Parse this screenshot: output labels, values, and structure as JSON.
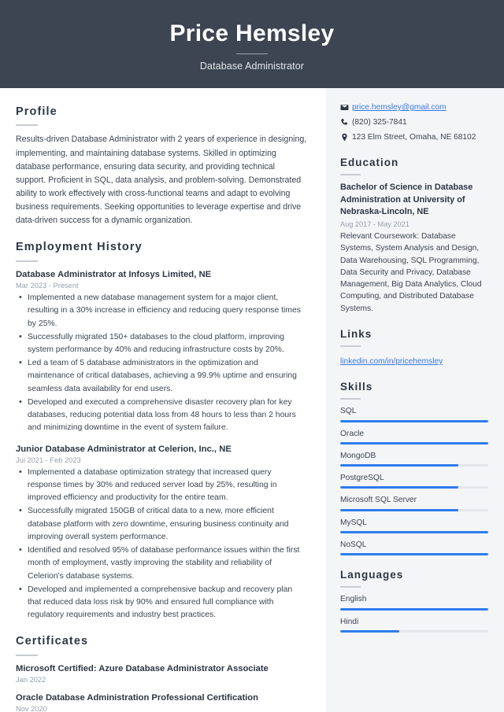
{
  "header": {
    "name": "Price Hemsley",
    "job_title": "Database Administrator"
  },
  "colors": {
    "header_bg": "#3d4552",
    "sidebar_bg": "#f4f5f7",
    "accent_blue": "#2e7dee",
    "link_blue": "#3a7ae0",
    "heading": "#2d3644",
    "muted": "#97a0ae"
  },
  "main": {
    "profile": {
      "heading": "Profile",
      "text": "Results-driven Database Administrator with 2 years of experience in designing, implementing, and maintaining database systems. Skilled in optimizing database performance, ensuring data security, and providing technical support. Proficient in SQL, data analysis, and problem-solving. Demonstrated ability to work effectively with cross-functional teams and adapt to evolving business requirements. Seeking opportunities to leverage expertise and drive data-driven success for a dynamic organization."
    },
    "employment": {
      "heading": "Employment History",
      "jobs": [
        {
          "title": "Database Administrator at Infosys Limited, NE",
          "date": "Mar 2023 - Present",
          "bullets": [
            "Implemented a new database management system for a major client, resulting in a 30% increase in efficiency and reducing query response times by 25%.",
            "Successfully migrated 150+ databases to the cloud platform, improving system performance by 40% and reducing infrastructure costs by 20%.",
            "Led a team of 5 database administrators in the optimization and maintenance of critical databases, achieving a 99.9% uptime and ensuring seamless data availability for end users.",
            "Developed and executed a comprehensive disaster recovery plan for key databases, reducing potential data loss from 48 hours to less than 2 hours and minimizing downtime in the event of system failure."
          ]
        },
        {
          "title": "Junior Database Administrator at Celerion, Inc., NE",
          "date": "Jul 2021 - Feb 2023",
          "bullets": [
            "Implemented a database optimization strategy that increased query response times by 30% and reduced server load by 25%, resulting in improved efficiency and productivity for the entire team.",
            "Successfully migrated 150GB of critical data to a new, more efficient database platform with zero downtime, ensuring business continuity and improving overall system performance.",
            "Identified and resolved 95% of database performance issues within the first month of employment, vastly improving the stability and reliability of Celerion's database systems.",
            "Developed and implemented a comprehensive backup and recovery plan that reduced data loss risk by 90% and ensured full compliance with regulatory requirements and industry best practices."
          ]
        }
      ]
    },
    "certificates": {
      "heading": "Certificates",
      "items": [
        {
          "title": "Microsoft Certified: Azure Database Administrator Associate",
          "date": "Jan 2022"
        },
        {
          "title": "Oracle Database Administration Professional Certification",
          "date": "Nov 2020"
        }
      ]
    }
  },
  "sidebar": {
    "contact": {
      "email": "price.hemsley@gmail.com",
      "phone": "(820) 325-7841",
      "address": "123 Elm Street, Omaha, NE 68102"
    },
    "education": {
      "heading": "Education",
      "items": [
        {
          "title": "Bachelor of Science in Database Administration at University of Nebraska-Lincoln, NE",
          "date": "Aug 2017 - May 2021",
          "description": "Relevant Coursework: Database Systems, System Analysis and Design, Data Warehousing, SQL Programming, Data Security and Privacy, Database Management, Big Data Analytics, Cloud Computing, and Distributed Database Systems."
        }
      ]
    },
    "links": {
      "heading": "Links",
      "items": [
        {
          "label": "linkedin.com/in/pricehemsley"
        }
      ]
    },
    "skills": {
      "heading": "Skills",
      "items": [
        {
          "label": "SQL",
          "level": 100
        },
        {
          "label": "Oracle",
          "level": 100
        },
        {
          "label": "MongoDB",
          "level": 80
        },
        {
          "label": "PostgreSQL",
          "level": 80
        },
        {
          "label": "Microsoft SQL Server",
          "level": 80
        },
        {
          "label": "MySQL",
          "level": 100
        },
        {
          "label": "NoSQL",
          "level": 100
        }
      ]
    },
    "languages": {
      "heading": "Languages",
      "items": [
        {
          "label": "English",
          "level": 100
        },
        {
          "label": "Hindi",
          "level": 40
        }
      ]
    }
  }
}
